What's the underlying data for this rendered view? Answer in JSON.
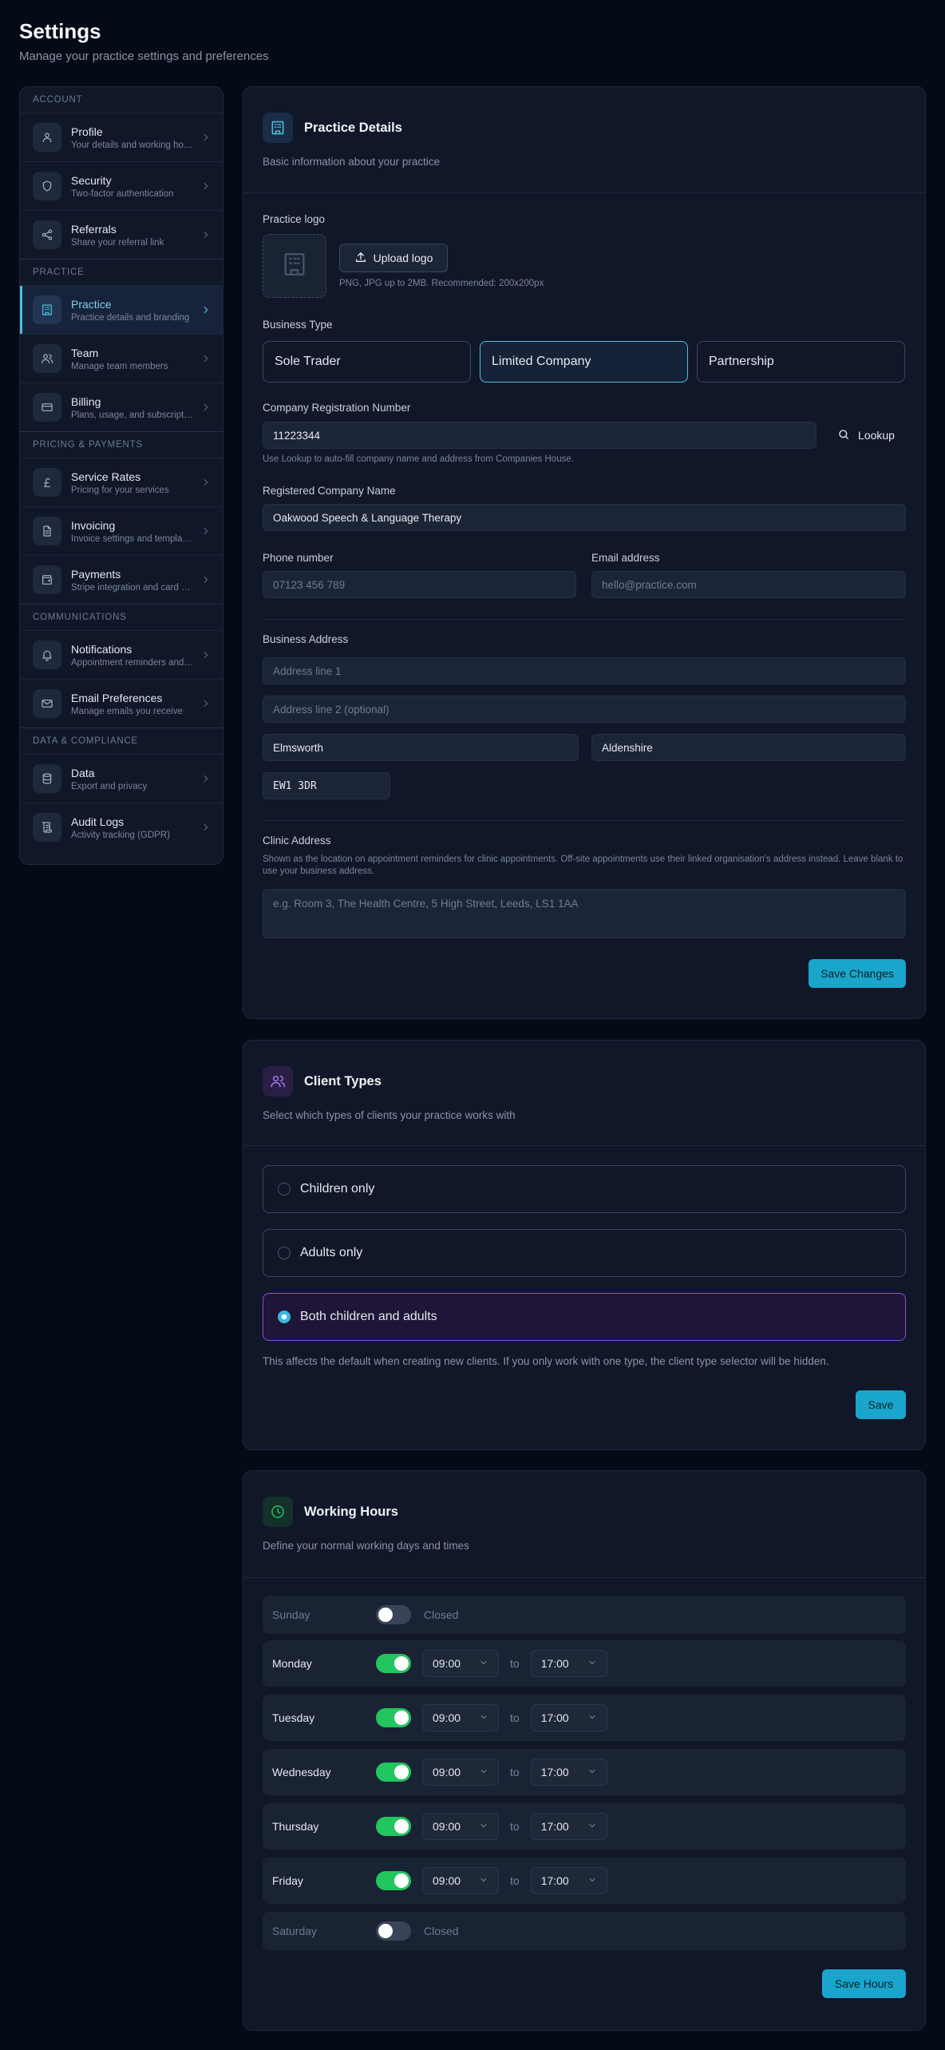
{
  "header": {
    "title": "Settings",
    "subtitle": "Manage your practice settings and preferences"
  },
  "sidebar": {
    "sections": [
      {
        "heading": "ACCOUNT",
        "items": [
          {
            "label": "Profile",
            "desc": "Your details and working hours",
            "icon": "user-icon"
          },
          {
            "label": "Security",
            "desc": "Two-factor authentication",
            "icon": "shield-icon"
          },
          {
            "label": "Referrals",
            "desc": "Share your referral link",
            "icon": "share-icon"
          }
        ]
      },
      {
        "heading": "PRACTICE",
        "items": [
          {
            "label": "Practice",
            "desc": "Practice details and branding",
            "icon": "building-icon",
            "active": true
          },
          {
            "label": "Team",
            "desc": "Manage team members",
            "icon": "users-icon"
          },
          {
            "label": "Billing",
            "desc": "Plans, usage, and subscriptions",
            "icon": "credit-card-icon"
          }
        ]
      },
      {
        "heading": "PRICING & PAYMENTS",
        "items": [
          {
            "label": "Service Rates",
            "desc": "Pricing for your services",
            "icon": "pound-icon"
          },
          {
            "label": "Invoicing",
            "desc": "Invoice settings and templates",
            "icon": "file-icon"
          },
          {
            "label": "Payments",
            "desc": "Stripe integration and card payments",
            "icon": "wallet-icon"
          }
        ]
      },
      {
        "heading": "COMMUNICATIONS",
        "items": [
          {
            "label": "Notifications",
            "desc": "Appointment reminders and alerts",
            "icon": "bell-icon"
          },
          {
            "label": "Email Preferences",
            "desc": "Manage emails you receive",
            "icon": "mail-icon"
          }
        ]
      },
      {
        "heading": "DATA & COMPLIANCE",
        "items": [
          {
            "label": "Data",
            "desc": "Export and privacy",
            "icon": "database-icon"
          },
          {
            "label": "Audit Logs",
            "desc": "Activity tracking (GDPR)",
            "icon": "scroll-icon"
          }
        ]
      }
    ]
  },
  "practice": {
    "title": "Practice Details",
    "desc": "Basic information about your practice",
    "logo_label": "Practice logo",
    "upload_label": "Upload logo",
    "logo_hint": "PNG, JPG up to 2MB. Recommended: 200x200px",
    "business_type_label": "Business Type",
    "business_types": [
      "Sole Trader",
      "Limited Company",
      "Partnership"
    ],
    "selected_business_type": "Limited Company",
    "reg_label": "Company Registration Number",
    "reg_value": "11223344",
    "lookup_label": "Lookup",
    "reg_hint": "Use Lookup to auto-fill company name and address from Companies House.",
    "company_name_label": "Registered Company Name",
    "company_name_value": "Oakwood Speech & Language Therapy",
    "phone_label": "Phone number",
    "phone_placeholder": "07123 456 789",
    "email_label": "Email address",
    "email_placeholder": "hello@practice.com",
    "address_label": "Business Address",
    "address1_placeholder": "Address line 1",
    "address2_placeholder": "Address line 2 (optional)",
    "city_value": "Elmsworth",
    "county_value": "Aldenshire",
    "postcode_value": "EW1 3DR",
    "clinic_label": "Clinic Address",
    "clinic_hint": "Shown as the location on appointment reminders for clinic appointments. Off-site appointments use their linked organisation's address instead. Leave blank to use your business address.",
    "clinic_placeholder": "e.g. Room 3, The Health Centre, 5 High Street, Leeds, LS1 1AA",
    "save_label": "Save Changes"
  },
  "client_types": {
    "title": "Client Types",
    "desc": "Select which types of clients your practice works with",
    "options": [
      "Children only",
      "Adults only",
      "Both children and adults"
    ],
    "selected": "Both children and adults",
    "note": "This affects the default when creating new clients. If you only work with one type, the client type selector will be hidden.",
    "save_label": "Save"
  },
  "working_hours": {
    "title": "Working Hours",
    "desc": "Define your normal working days and times",
    "closed_label": "Closed",
    "to_label": "to",
    "days": [
      {
        "name": "Sunday",
        "enabled": false
      },
      {
        "name": "Monday",
        "enabled": true,
        "start": "09:00",
        "end": "17:00"
      },
      {
        "name": "Tuesday",
        "enabled": true,
        "start": "09:00",
        "end": "17:00"
      },
      {
        "name": "Wednesday",
        "enabled": true,
        "start": "09:00",
        "end": "17:00"
      },
      {
        "name": "Thursday",
        "enabled": true,
        "start": "09:00",
        "end": "17:00"
      },
      {
        "name": "Friday",
        "enabled": true,
        "start": "09:00",
        "end": "17:00"
      },
      {
        "name": "Saturday",
        "enabled": false
      }
    ],
    "save_label": "Save Hours"
  },
  "colors": {
    "accent": "#1aa6cc",
    "purple": "#8a4fe8",
    "green": "#22c55e"
  }
}
